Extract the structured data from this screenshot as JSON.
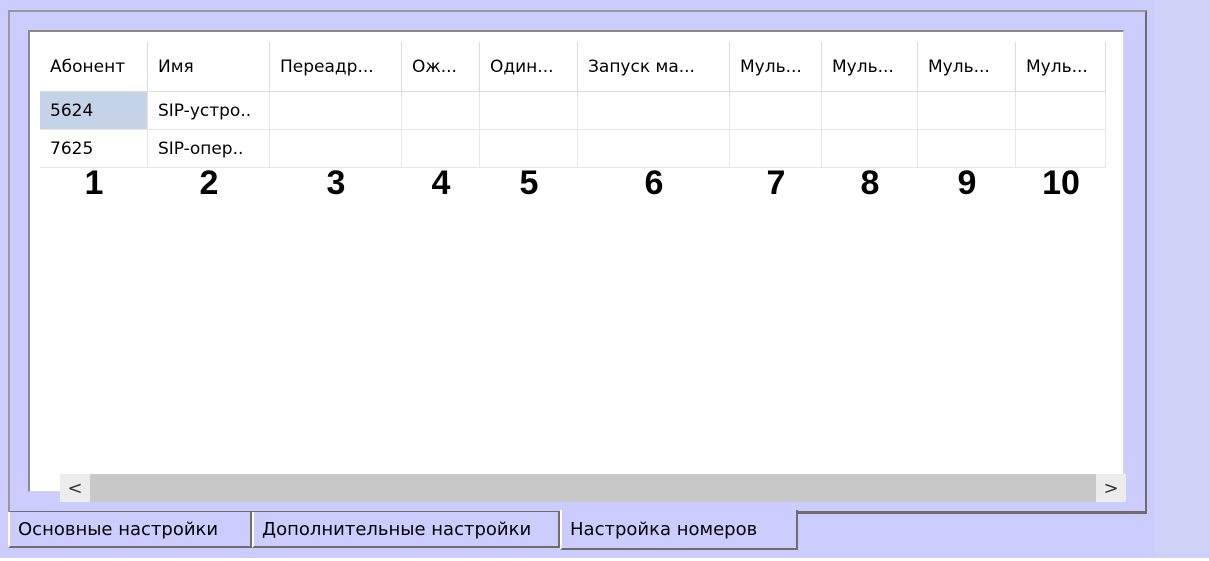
{
  "grid": {
    "columns": [
      "Абонент",
      "Имя",
      "Переадр...",
      "Ож...",
      "Один...",
      "Запуск ма...",
      "Муль...",
      "Муль...",
      "Муль...",
      "Муль..."
    ],
    "rows": [
      [
        "5624",
        "SIP-устро..",
        "",
        "",
        "",
        "",
        "",
        "",
        "",
        ""
      ],
      [
        "7625",
        "SIP-опер..",
        "",
        "",
        "",
        "",
        "",
        "",
        "",
        ""
      ]
    ],
    "selected_cell": "5624"
  },
  "column_markers": [
    "1",
    "2",
    "3",
    "4",
    "5",
    "6",
    "7",
    "8",
    "9",
    "10"
  ],
  "scrollbar": {
    "left_arrow": "<",
    "right_arrow": ">"
  },
  "tabs": [
    {
      "label": "Основные настройки",
      "active": false
    },
    {
      "label": "Дополнительные настройки",
      "active": false
    },
    {
      "label": "Настройка номеров",
      "active": true
    }
  ],
  "colors": {
    "panel_bg": "#ccccff",
    "selection": "#c5d3e8"
  }
}
